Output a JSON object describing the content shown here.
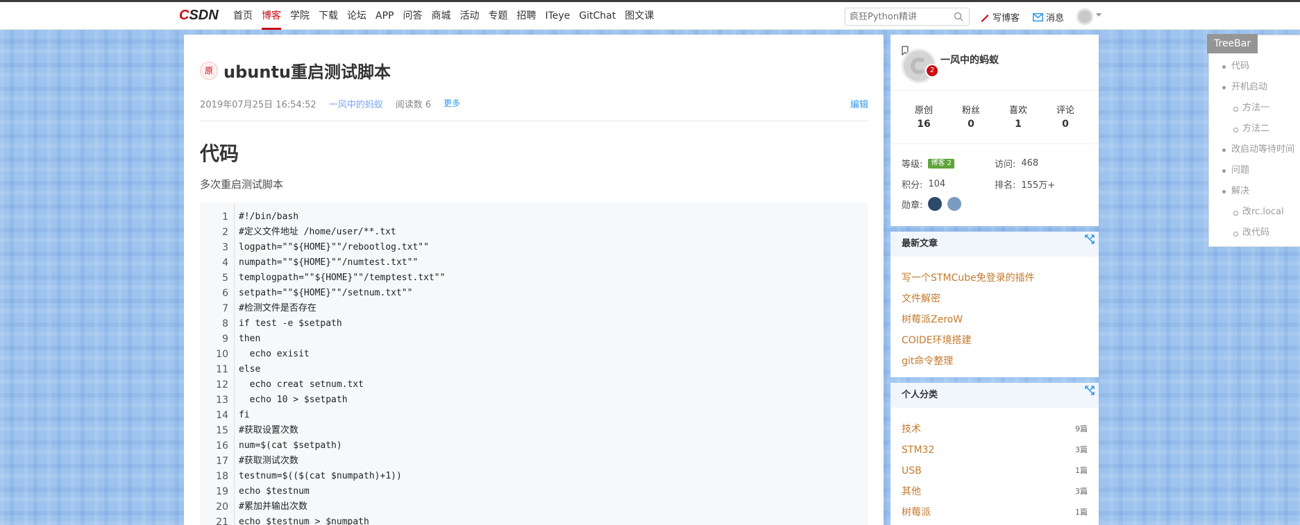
{
  "topbar": {
    "logo_text": "CSDN",
    "nav": [
      "首页",
      "博客",
      "学院",
      "下载",
      "论坛",
      "APP",
      "问答",
      "商城",
      "活动",
      "专题",
      "招聘",
      "ITeye",
      "GitChat",
      "图文课"
    ],
    "active_nav": "博客",
    "search_placeholder": "疯狂Python精讲",
    "write_label": "写博客",
    "message_label": "消息",
    "brand_color": "#ca0c16"
  },
  "article": {
    "badge": "原",
    "title": "ubuntu重启测试脚本",
    "date": "2019年07月25日 16:54:52",
    "author": "一风中的蚂蚁",
    "read_count": "阅读数 6",
    "more": "更多",
    "edit": "编辑",
    "heading": "代码",
    "paragraph": "多次重启测试脚本",
    "code_lines": [
      "#!/bin/bash",
      "#定义文件地址 /home/user/**.txt",
      "logpath=\"\"${HOME}\"\"/rebootlog.txt\"\"",
      "numpath=\"\"${HOME}\"\"/numtest.txt\"\"",
      "templogpath=\"\"${HOME}\"\"/temptest.txt\"\"",
      "setpath=\"\"${HOME}\"\"/setnum.txt\"\"",
      "#检测文件是否存在",
      "if test -e $setpath",
      "then",
      "  echo exisit",
      "else",
      "  echo creat setnum.txt",
      "  echo 10 > $setpath",
      "fi",
      "#获取设置次数",
      "num=$(cat $setpath)",
      "#获取测试次数",
      "testnum=$(($(cat $numpath)+1))",
      "echo $testnum",
      "#累加并输出次数",
      "echo $testnum > $numpath"
    ],
    "line_numbers": [
      "1",
      "2",
      "3",
      "4",
      "5",
      "6",
      "7",
      "8",
      "9",
      "10",
      "11",
      "12",
      "13",
      "14",
      "15",
      "16",
      "17",
      "18",
      "19",
      "20",
      "21"
    ]
  },
  "profile": {
    "name": "一风中的蚂蚁",
    "level_number": "2",
    "stats": [
      {
        "label": "原创",
        "value": "16"
      },
      {
        "label": "粉丝",
        "value": "0"
      },
      {
        "label": "喜欢",
        "value": "1"
      },
      {
        "label": "评论",
        "value": "0"
      }
    ],
    "level_label": "等级:",
    "level_badge": "博客 2",
    "visits_label": "访问:",
    "visits_value": "468",
    "points_label": "积分:",
    "points_value": "104",
    "rank_label": "排名:",
    "rank_value": "155万+",
    "medals_label": "勋章:"
  },
  "recent": {
    "title": "最新文章",
    "items": [
      "写一个STMCube免登录的插件",
      "文件解密",
      "树莓派ZeroW",
      "COIDE环境搭建",
      "git命令整理"
    ]
  },
  "categories": {
    "title": "个人分类",
    "items": [
      {
        "name": "技术",
        "count": "9篇"
      },
      {
        "name": "STM32",
        "count": "3篇"
      },
      {
        "name": "USB",
        "count": "1篇"
      },
      {
        "name": "其他",
        "count": "3篇"
      },
      {
        "name": "树莓派",
        "count": "1篇"
      }
    ]
  },
  "treebar": {
    "title": "TreeBar",
    "items": [
      {
        "label": "代码",
        "level": 1
      },
      {
        "label": "开机启动",
        "level": 1
      },
      {
        "label": "方法一",
        "level": 2
      },
      {
        "label": "方法二",
        "level": 2
      },
      {
        "label": "改启动等待时间",
        "level": 1
      },
      {
        "label": "问题",
        "level": 1
      },
      {
        "label": "解决",
        "level": 1
      },
      {
        "label": "改rc.local",
        "level": 2
      },
      {
        "label": "改代码",
        "level": 2
      }
    ]
  }
}
